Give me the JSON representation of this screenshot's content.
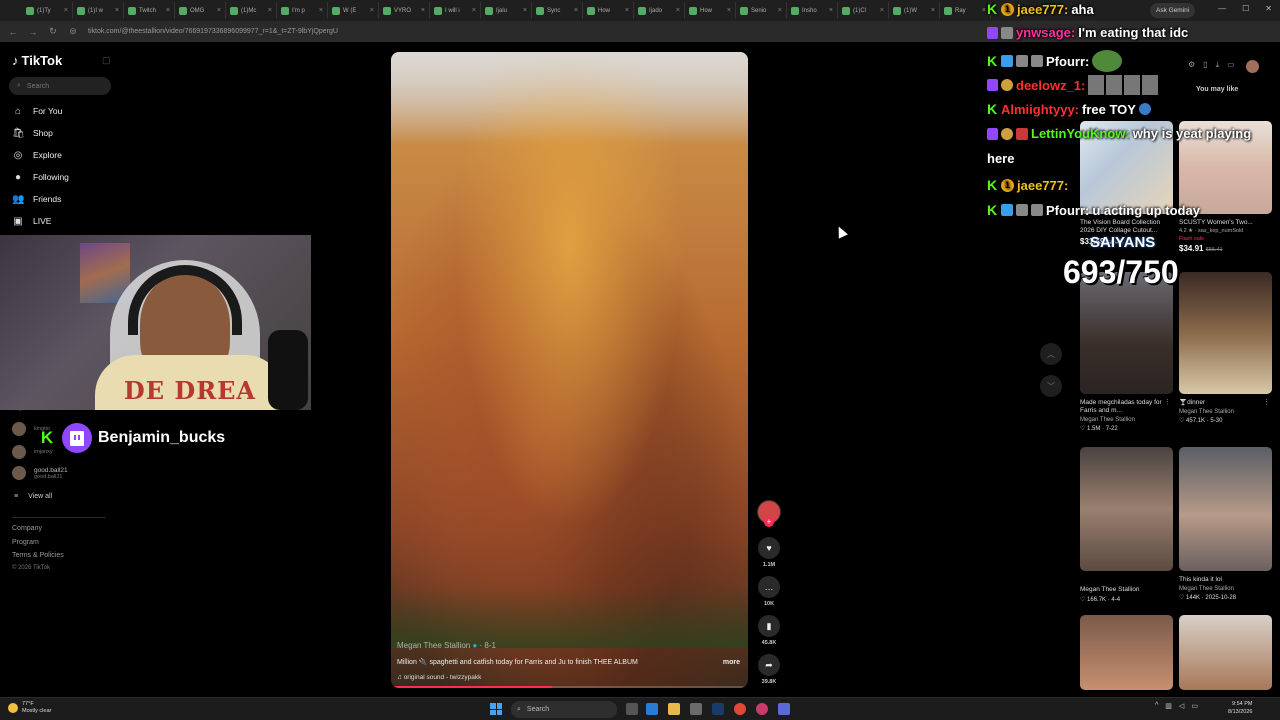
{
  "browser": {
    "tabs": [
      {
        "label": "(1)Ty"
      },
      {
        "label": "(1)I w"
      },
      {
        "label": "Twitch"
      },
      {
        "label": "OMG"
      },
      {
        "label": "(1)Mc"
      },
      {
        "label": "I'm p"
      },
      {
        "label": "W (E"
      },
      {
        "label": "VYRO"
      },
      {
        "label": "I will i"
      },
      {
        "label": "Ijalu"
      },
      {
        "label": "Sync"
      },
      {
        "label": "How"
      },
      {
        "label": "Ijado"
      },
      {
        "label": "How"
      },
      {
        "label": "Senio"
      },
      {
        "label": "Insho"
      },
      {
        "label": "(1)Cl"
      },
      {
        "label": "(1)W"
      },
      {
        "label": "Ray"
      }
    ],
    "url": "tiktok.com/@theestallion/video/7669197336896099977_r=1&_t=ZT-9lbYjQpergU",
    "ask_gemini": "Ask Gemini"
  },
  "tiktok": {
    "logo": "TikTok",
    "search_placeholder": "Search",
    "nav": [
      {
        "label": "For You",
        "icon": "home-icon"
      },
      {
        "label": "Shop",
        "icon": "bag-icon"
      },
      {
        "label": "Explore",
        "icon": "compass-icon"
      },
      {
        "label": "Following",
        "icon": "people-icon"
      },
      {
        "label": "Friends",
        "icon": "friends-icon"
      },
      {
        "label": "LIVE",
        "icon": "live-icon"
      }
    ],
    "following": [
      {
        "name": "kingtio",
        "handle": ""
      },
      {
        "name": "",
        "handle": "kingtio"
      },
      {
        "name": "",
        "handle": "imjanxy"
      },
      {
        "name": "good.ball21",
        "handle": "good.ball21"
      }
    ],
    "view_all": "View all",
    "footer": [
      "Company",
      "Program",
      "Terms & Policies",
      "© 2026 TikTok"
    ]
  },
  "stream_overlay": {
    "twitch_name": "Benjamin_bucks",
    "shirt_text": "DE DREA",
    "chat": [
      {
        "user": "jaee777:",
        "msg": "aha",
        "user_color": "#f0c020"
      },
      {
        "user": "ynwsage:",
        "msg": "I'm eating that idc",
        "user_color": "#ff2fa0"
      },
      {
        "user": "Pfourr:",
        "msg": "",
        "user_color": "#ffffff"
      },
      {
        "user": "deelowz_1:",
        "msg": "",
        "user_color": "#ff3030"
      },
      {
        "user": "Almiightyyy:",
        "msg": "free TOY",
        "user_color": "#ff3030"
      },
      {
        "user": "LettinYouKnow:",
        "msg": "why is yeat playing",
        "user_color": "#53fc18"
      },
      {
        "user": "",
        "msg": "here",
        "user_color": "#ffffff"
      },
      {
        "user": "jaee777:",
        "msg": "",
        "user_color": "#f0c020"
      },
      {
        "user": "Pfourr:",
        "msg": "u acting up today",
        "user_color": "#ffffff"
      }
    ],
    "goal_label": "SAIYANS",
    "goal_count": "693/750"
  },
  "video": {
    "author": "Megan Thee Stallion",
    "date": "8-1",
    "caption": "Million 🔌 spaghetti and catfish today for Farris and Ju to finish THEE ALBUM",
    "more": "more",
    "sound": "original sound - twizzypakk",
    "progress": 0.45,
    "counts": {
      "likes": "1.1M",
      "comments": "10K",
      "saves": "45.8K",
      "shares": "39.8K"
    }
  },
  "right_panel": {
    "you_may_like": "You may like",
    "cards": [
      {
        "title": "The Vision Board Collection 2026 DIY Collage Cutout...",
        "price": "$31.49",
        "old_price": "$34.99",
        "rating": "",
        "badge": "",
        "author": "",
        "stats": ""
      },
      {
        "title": "SCUSTY Women's Two...",
        "price": "$34.91",
        "old_price": "$55.41",
        "rating": "4.2 ★ · sas_kep_numSold",
        "badge": "Flash sale",
        "author": "",
        "stats": ""
      },
      {
        "title": "Made megchiladas today for Farris and m...",
        "author": "Megan Thee Stallion",
        "stats": "1.5M · 7-22"
      },
      {
        "title": "🍸dinner",
        "author": "Megan Thee Stallion",
        "stats": "457.1K · 5-30"
      },
      {
        "title": "",
        "author": "Megan Thee Stallion",
        "stats": "166.7K · 4-4"
      },
      {
        "title": "This kinda it lol",
        "author": "Megan Thee Stallion",
        "stats": "144K · 2025-10-28"
      }
    ]
  },
  "taskbar": {
    "weather_temp": "77°F",
    "weather_desc": "Mostly clear",
    "search": "Search",
    "time": "9:54 PM",
    "date": "8/13/2026"
  },
  "colors": {
    "tiktok_red": "#fe2c55",
    "kick_green": "#53fc18",
    "twitch_purple": "#9146ff"
  }
}
